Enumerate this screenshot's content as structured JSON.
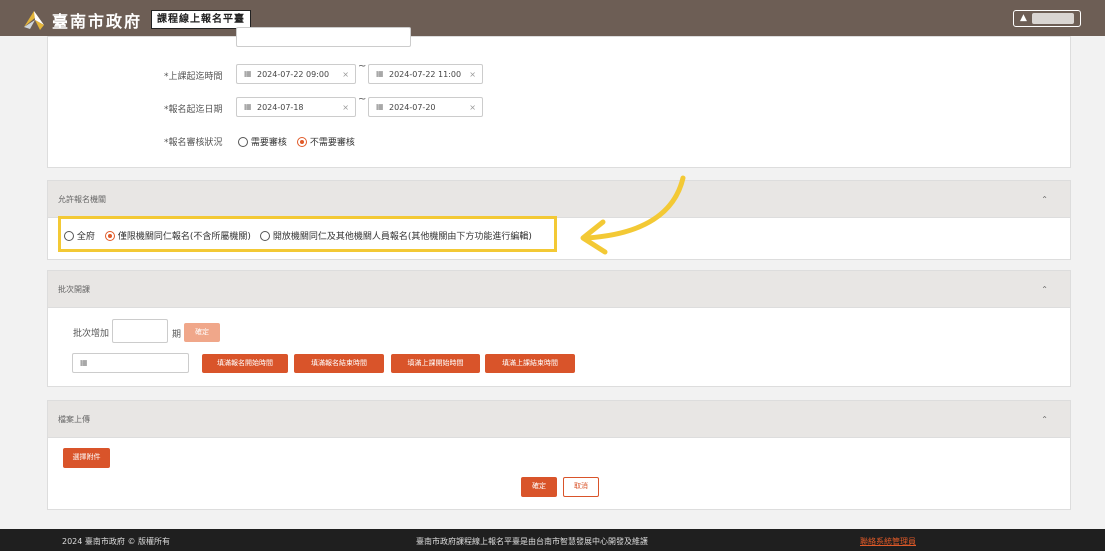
{
  "header": {
    "site_title": "臺南市政府",
    "platform": "課程線上報名平臺"
  },
  "schedule": {
    "class_time_label": "*上課起迄時間",
    "class_start": "2024-07-22 09:00",
    "class_end": "2024-07-22 11:00",
    "signup_label": "*報名起迄日期",
    "signup_start": "2024-07-18",
    "signup_end": "2024-07-20",
    "separator": "~",
    "review_label": "*報名審核狀況",
    "review_options": [
      "需要審核",
      "不需要審核"
    ],
    "review_selected": 1
  },
  "allowed_orgs": {
    "title": "允許報名機關",
    "options": [
      "全府",
      "僅限機關同仁報名(不含所屬機關)",
      "開放機關同仁及其他機關人員報名(其他機關由下方功能進行編輯)"
    ],
    "selected": 1
  },
  "batch": {
    "title": "批次開課",
    "add_label": "批次增加",
    "add_value": "",
    "unit": "期",
    "confirm_label": "確定",
    "date_placeholder": "",
    "fill_buttons": [
      "填滿報名開始時間",
      "填滿報名結束時間",
      "填滿上課開始時間",
      "填滿上課結束時間"
    ]
  },
  "upload": {
    "title": "檔案上傳",
    "select_label": "選擇附件"
  },
  "actions": {
    "submit": "確定",
    "cancel": "取消"
  },
  "footer": {
    "copyright": "2024 臺南市政府 © 版權所有",
    "credit": "臺南市政府課程線上報名平臺是由台南市智慧發展中心開發及維護",
    "contact": "聯絡系統管理員"
  },
  "colors": {
    "header_bg": "#6d5e55",
    "accent": "#d9542a",
    "highlight": "#f3c935"
  }
}
